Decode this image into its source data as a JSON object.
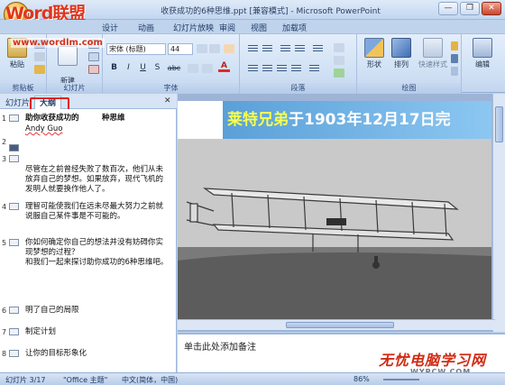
{
  "window": {
    "title": "收获成功的6种思维.ppt [兼容模式] - Microsoft PowerPoint",
    "controls": [
      "—",
      "❐",
      "✕"
    ]
  },
  "watermark": {
    "logo": "Word联盟",
    "url": "www.wordlm.com",
    "bottom_text": "无忧电脑学习网",
    "bottom_url": "WYPCW.COM"
  },
  "ribbon_tabs": [
    "设计",
    "动画",
    "幻灯片放映",
    "审阅",
    "视图",
    "加载项"
  ],
  "ribbon": {
    "clipboard": {
      "paste": "粘贴",
      "group": "剪贴板"
    },
    "slides": {
      "new_slide": "新建\n幻灯片",
      "group": "幻灯片"
    },
    "font": {
      "font_name": "宋体 (标题)",
      "font_size": "44",
      "bold": "B",
      "italic": "I",
      "underline": "U",
      "shadow": "S",
      "strike": "abc",
      "font_color": "A",
      "group": "字体"
    },
    "paragraph": {
      "group": "段落"
    },
    "drawing": {
      "shape": "形状",
      "arrange": "排列",
      "quick_styles": "快速样式",
      "group": "绘图"
    },
    "editing": {
      "label": "编辑"
    }
  },
  "panel": {
    "tab_slides": "幻灯片",
    "tab_outline": "大纲",
    "close": "✕"
  },
  "outline": [
    {
      "num": "1",
      "text": "助你收获成功的　　　种思维",
      "bold": true
    },
    {
      "num": "",
      "text": "Andy Guo",
      "sub": true
    },
    {
      "num": "2",
      "text": ""
    },
    {
      "num": "3",
      "text": ""
    },
    {
      "num": "",
      "text": "尽管在之前曾经失败了数百次，他们从未放弃自己的梦想。如果放弃，现代飞机的发明人就要换作他人了。"
    },
    {
      "num": "4",
      "text": "理智可能使我们在远未尽最大努力之前就说服自己某件事是不可能的。"
    },
    {
      "num": "5",
      "text": "你如何确定你自己的想法并没有妨碍你实现梦想的过程？\n和我们一起来探讨助你成功的6种思维吧。"
    },
    {
      "num": "6",
      "text": "明了自己的局限"
    },
    {
      "num": "7",
      "text": "制定计划"
    },
    {
      "num": "8",
      "text": "让你的目标形象化"
    }
  ],
  "slide": {
    "title_highlight": "莱特兄弟",
    "title_rest": "于1903年12月17日完"
  },
  "notes": {
    "placeholder": "单击此处添加备注"
  },
  "status": {
    "slide_pos": "幻灯片 3/17",
    "theme": "\"Office 主题\"",
    "language": "中文(简体，中国)",
    "zoom": "86%"
  }
}
